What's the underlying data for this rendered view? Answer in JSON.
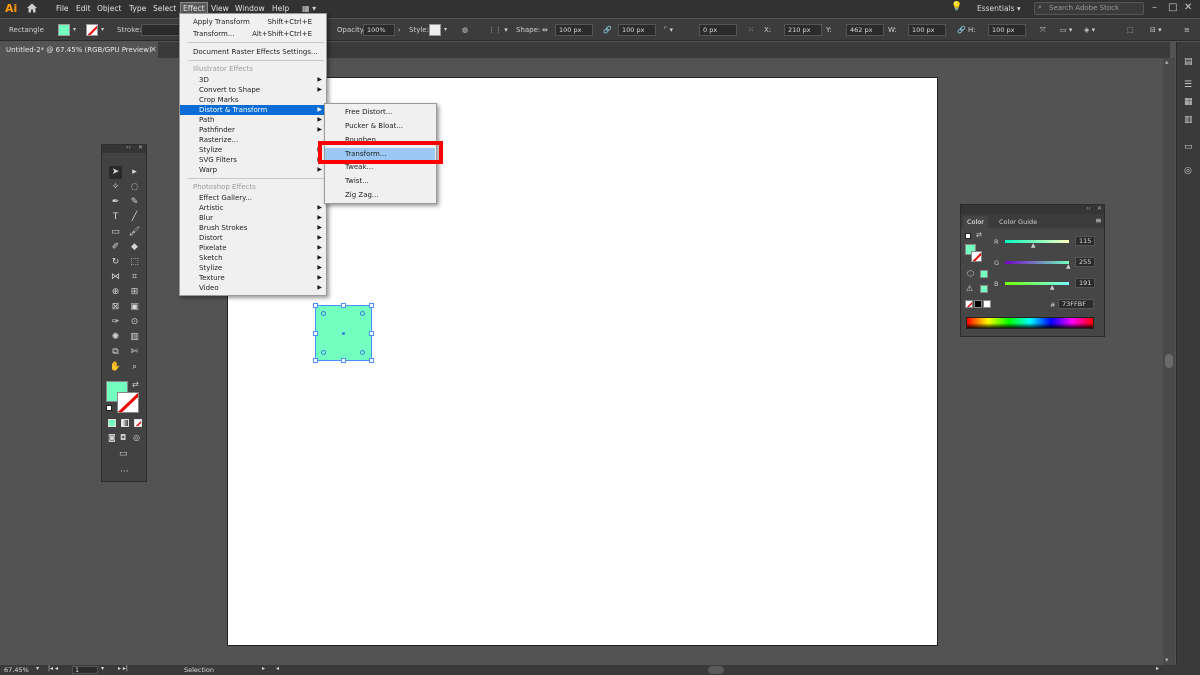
{
  "app": {
    "logo": "Ai"
  },
  "menubar": {
    "items": [
      "File",
      "Edit",
      "Object",
      "Type",
      "Select",
      "Effect",
      "View",
      "Window",
      "Help"
    ],
    "active": "Effect",
    "workspace": "Essentials",
    "search_placeholder": "Search Adobe Stock"
  },
  "controlbar": {
    "object_type": "Rectangle",
    "stroke_label": "Stroke:",
    "opacity_label": "Opacity:",
    "opacity_value": "100%",
    "style_label": "Style:",
    "shape_label": "Shape:",
    "shape_w": "100 px",
    "shape_h": "100 px",
    "corner": "0 px",
    "x_label": "X:",
    "x_value": "210 px",
    "y_label": "Y:",
    "y_value": "462 px",
    "w_label": "W:",
    "w_value": "100 px",
    "h_label": "H:",
    "h_value": "100 px",
    "fill_color": "#73FFBF"
  },
  "document": {
    "tab_title": "Untitled-2* @ 67.45% (RGB/GPU Preview)"
  },
  "effect_menu": {
    "apply_transform": "Apply Transform",
    "apply_transform_shortcut": "Shift+Ctrl+E",
    "transform": "Transform...",
    "transform_shortcut": "Alt+Shift+Ctrl+E",
    "doc_raster": "Document Raster Effects Settings...",
    "illustrator_header": "Illustrator Effects",
    "illustrator_items": [
      "3D",
      "Convert to Shape",
      "Crop Marks",
      "Distort & Transform",
      "Path",
      "Pathfinder",
      "Rasterize...",
      "Stylize",
      "SVG Filters",
      "Warp"
    ],
    "photoshop_header": "Photoshop Effects",
    "photoshop_items": [
      "Effect Gallery...",
      "Artistic",
      "Blur",
      "Brush Strokes",
      "Distort",
      "Pixelate",
      "Sketch",
      "Stylize",
      "Texture",
      "Video"
    ],
    "highlighted": "Distort & Transform"
  },
  "submenu": {
    "items": [
      "Free Distort...",
      "Pucker & Bloat...",
      "Roughen...",
      "Transform...",
      "Tweak...",
      "Twist...",
      "Zig Zag..."
    ],
    "highlighted": "Transform..."
  },
  "color_panel": {
    "tab_color": "Color",
    "tab_guide": "Color Guide",
    "r_label": "R",
    "r_value": "115",
    "r_level": 115,
    "g_label": "G",
    "g_value": "255",
    "g_level": 255,
    "b_label": "B",
    "b_value": "191",
    "b_level": 191,
    "hex_label": "#",
    "hex_value": "73FFBF",
    "swatch_color": "#73FFBF"
  },
  "statusbar": {
    "zoom": "67.45%",
    "artboard_num": "1",
    "tool_name": "Selection"
  }
}
